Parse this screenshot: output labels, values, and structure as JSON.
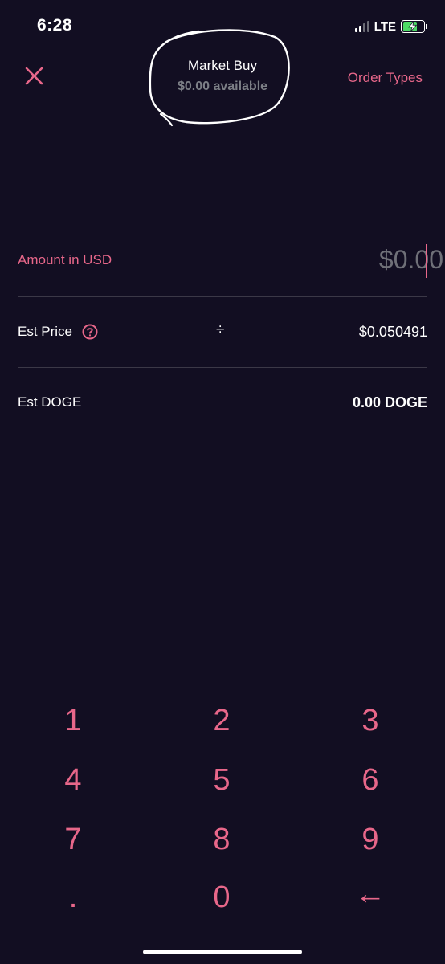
{
  "colors": {
    "background": "#120e22",
    "accent": "#e8678a",
    "muted": "#7c7f86",
    "divider": "#3b3847",
    "battery_fill": "#4cd964"
  },
  "status_bar": {
    "time": "6:28",
    "network": "LTE",
    "signal_icon": "cellular-signal-icon",
    "battery_icon": "battery-charging-icon"
  },
  "header": {
    "close_icon": "close-icon",
    "title": "Market Buy",
    "subtitle": "$0.00 available",
    "order_types_label": "Order Types"
  },
  "amount": {
    "label": "Amount in USD",
    "placeholder": "$0.00"
  },
  "est_price": {
    "label": "Est Price",
    "help_icon": "help-icon",
    "divide_icon_glyph": "÷",
    "value": "$0.050491"
  },
  "est_doge": {
    "label": "Est DOGE",
    "value": "0.00 DOGE"
  },
  "keypad": {
    "keys": [
      "1",
      "2",
      "3",
      "4",
      "5",
      "6",
      "7",
      "8",
      "9",
      ".",
      "0",
      "←"
    ]
  }
}
